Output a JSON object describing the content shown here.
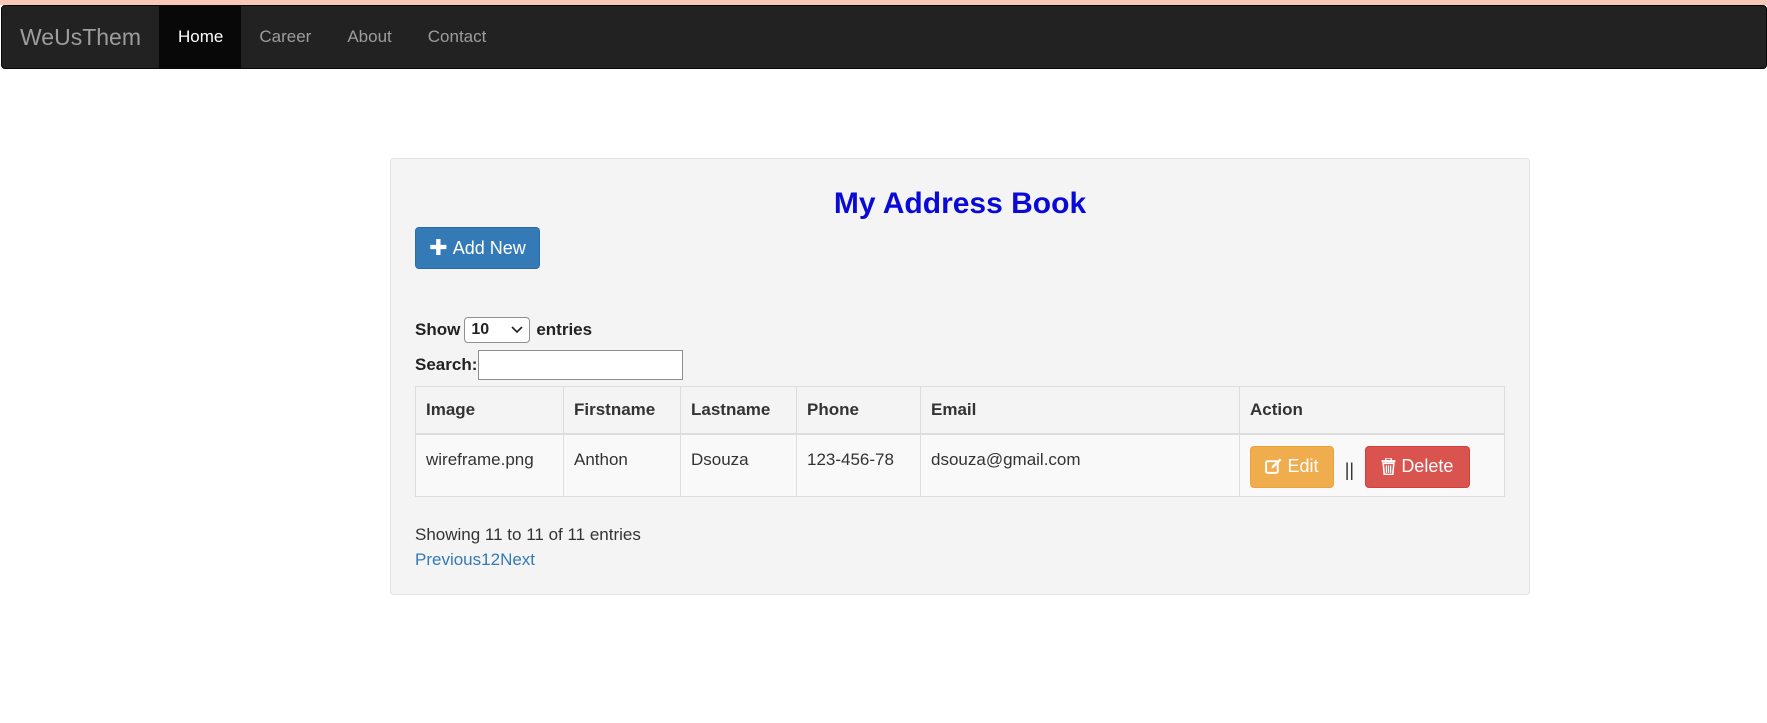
{
  "nav": {
    "brand": "WeUsThem",
    "items": [
      {
        "label": "Home",
        "active": true
      },
      {
        "label": "Career",
        "active": false
      },
      {
        "label": "About",
        "active": false
      },
      {
        "label": "Contact",
        "active": false
      }
    ]
  },
  "page": {
    "title": "My Address Book",
    "add_button": "Add New",
    "show_label": "Show",
    "entries_value": "10",
    "entries_label": "entries",
    "search_label": "Search:",
    "search_value": ""
  },
  "table": {
    "columns": [
      "Image",
      "Firstname",
      "Lastname",
      "Phone",
      "Email",
      "Action"
    ],
    "rows": [
      {
        "image": "wireframe.png",
        "firstname": "Anthon",
        "lastname": "Dsouza",
        "phone": "123-456-78",
        "email": "dsouza@gmail.com"
      }
    ],
    "edit_label": "Edit",
    "separator": "||",
    "delete_label": "Delete"
  },
  "footer": {
    "info": "Showing 11 to 11 of 11 entries",
    "pagination": [
      "Previous",
      "1",
      "2",
      "Next"
    ]
  },
  "colors": {
    "title": "#0a0ad8",
    "primary": "#337ab7",
    "warning": "#f0ad4e",
    "danger": "#d9534f",
    "navbar": "#222222"
  }
}
